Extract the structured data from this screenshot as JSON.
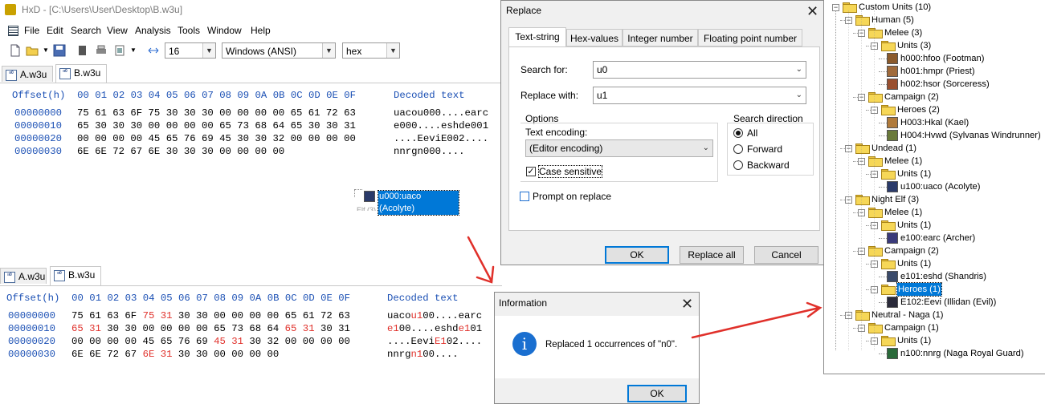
{
  "hxd": {
    "title": "HxD - [C:\\Users\\User\\Desktop\\B.w3u]",
    "menu": [
      "File",
      "Edit",
      "Search",
      "View",
      "Analysis",
      "Tools",
      "Window",
      "Help"
    ],
    "toolbar": {
      "bytes_per_row": "16",
      "charset": "Windows (ANSI)",
      "offset_base": "hex"
    }
  },
  "editor_top": {
    "tabs": [
      "A.w3u",
      "B.w3u"
    ],
    "active_tab": "B.w3u",
    "header": "Offset(h)  00 01 02 03 04 05 06 07 08 09 0A 0B 0C 0D 0E 0F",
    "decoded_header": "Decoded text",
    "rows": [
      {
        "offset": "00000000",
        "hex": "75 61 63 6F 75 30 30 30 00 00 00 00 65 61 72 63",
        "text": "uacou000....earc"
      },
      {
        "offset": "00000010",
        "hex": "65 30 30 30 00 00 00 00 65 73 68 64 65 30 30 31",
        "text": "e000....eshde001"
      },
      {
        "offset": "00000020",
        "hex": "00 00 00 00 45 65 76 69 45 30 30 32 00 00 00 00",
        "text": "....EeviE002...."
      },
      {
        "offset": "00000030",
        "hex": "6E 6E 72 67 6E 30 30 30 00 00 00 00",
        "text": "nnrgn000...."
      }
    ]
  },
  "editor_bottom": {
    "tabs": [
      "A.w3u",
      "B.w3u"
    ],
    "active_tab": "B.w3u",
    "header": "Offset(h)  00 01 02 03 04 05 06 07 08 09 0A 0B 0C 0D 0E 0F",
    "decoded_header": "Decoded text",
    "rows": [
      {
        "offset": "00000000",
        "hex_a": "75 61 63 6F ",
        "hex_b": "75 31",
        "hex_c": " 30 30 00 00 00 00 65 61 72 63",
        "text_a": "uaco",
        "text_b": "u1",
        "text_c": "00....earc"
      },
      {
        "offset": "00000010",
        "hex_a": "",
        "hex_b": "65 31",
        "hex_c": " 30 30 00 00 00 00 65 73 68 64 ",
        "hex_d": "65 31",
        "hex_e": " 30 31",
        "text_a": "",
        "text_b": "e1",
        "text_c": "00....eshd",
        "text_d": "e1",
        "text_e": "01"
      },
      {
        "offset": "00000020",
        "hex_a": "00 00 00 00 45 65 76 69 ",
        "hex_b": "45 31",
        "hex_c": " 30 32 00 00 00 00",
        "text_a": "....Eevi",
        "text_b": "E1",
        "text_c": "02...."
      },
      {
        "offset": "00000030",
        "hex_a": "6E 6E 72 67 ",
        "hex_b": "6E 31",
        "hex_c": " 30 30 00 00 00 00",
        "text_a": "nnrg",
        "text_b": "n1",
        "text_c": "00...."
      }
    ]
  },
  "drag_item": {
    "label": "u000:uaco (Acolyte)",
    "behind": "Elf (3)"
  },
  "replace_dialog": {
    "title": "Replace",
    "tabs": [
      "Text-string",
      "Hex-values",
      "Integer number",
      "Floating point number"
    ],
    "search_for_label": "Search for:",
    "search_for_value": "u0",
    "replace_with_label": "Replace with:",
    "replace_with_value": "u1",
    "options_label": "Options",
    "text_encoding_label": "Text encoding:",
    "text_encoding_value": "(Editor encoding)",
    "case_sensitive_label": "Case sensitive",
    "case_sensitive": true,
    "prompt_label": "Prompt on replace",
    "prompt": false,
    "direction_label": "Search direction",
    "directions": [
      "All",
      "Forward",
      "Backward"
    ],
    "direction_selected": "All",
    "ok": "OK",
    "replace_all": "Replace all",
    "cancel": "Cancel"
  },
  "info_dialog": {
    "title": "Information",
    "message": "Replaced 1 occurrences of \"n0\".",
    "ok": "OK"
  },
  "tree": {
    "nodes": [
      {
        "label": "Custom Units (10)",
        "depth": 0,
        "kind": "folder"
      },
      {
        "label": "Human (5)",
        "depth": 1,
        "kind": "folder"
      },
      {
        "label": "Melee (3)",
        "depth": 2,
        "kind": "folder"
      },
      {
        "label": "Units (3)",
        "depth": 3,
        "kind": "folder"
      },
      {
        "label": "h000:hfoo (Footman)",
        "depth": 4,
        "kind": "unit",
        "color": "#8b5a2b"
      },
      {
        "label": "h001:hmpr (Priest)",
        "depth": 4,
        "kind": "unit",
        "color": "#a06a3a"
      },
      {
        "label": "h002:hsor (Sorceress)",
        "depth": 4,
        "kind": "unit",
        "color": "#9a5030"
      },
      {
        "label": "Campaign (2)",
        "depth": 2,
        "kind": "folder"
      },
      {
        "label": "Heroes (2)",
        "depth": 3,
        "kind": "folder"
      },
      {
        "label": "H003:Hkal (Kael)",
        "depth": 4,
        "kind": "unit",
        "color": "#b07a3a"
      },
      {
        "label": "H004:Hvwd (Sylvanas Windrunner)",
        "depth": 4,
        "kind": "unit",
        "color": "#6a7a3a"
      },
      {
        "label": "Undead (1)",
        "depth": 1,
        "kind": "folder"
      },
      {
        "label": "Melee (1)",
        "depth": 2,
        "kind": "folder"
      },
      {
        "label": "Units (1)",
        "depth": 3,
        "kind": "folder"
      },
      {
        "label": "u100:uaco (Acolyte)",
        "depth": 4,
        "kind": "unit",
        "color": "#2a3a6a"
      },
      {
        "label": "Night Elf (3)",
        "depth": 1,
        "kind": "folder"
      },
      {
        "label": "Melee (1)",
        "depth": 2,
        "kind": "folder"
      },
      {
        "label": "Units (1)",
        "depth": 3,
        "kind": "folder"
      },
      {
        "label": "e100:earc (Archer)",
        "depth": 4,
        "kind": "unit",
        "color": "#3a3a7a"
      },
      {
        "label": "Campaign (2)",
        "depth": 2,
        "kind": "folder"
      },
      {
        "label": "Units (1)",
        "depth": 3,
        "kind": "folder"
      },
      {
        "label": "e101:eshd (Shandris)",
        "depth": 4,
        "kind": "unit",
        "color": "#3a4a6a"
      },
      {
        "label": "Heroes (1)",
        "depth": 3,
        "kind": "folder",
        "selected": true
      },
      {
        "label": "E102:Eevi (Illidan (Evil))",
        "depth": 4,
        "kind": "unit",
        "color": "#2a2a3a"
      },
      {
        "label": "Neutral - Naga (1)",
        "depth": 1,
        "kind": "folder"
      },
      {
        "label": "Campaign (1)",
        "depth": 2,
        "kind": "folder"
      },
      {
        "label": "Units (1)",
        "depth": 3,
        "kind": "folder"
      },
      {
        "label": "n100:nnrg (Naga Royal Guard)",
        "depth": 4,
        "kind": "unit",
        "color": "#2a6a3a"
      }
    ]
  },
  "annotation_color": "#e0302a"
}
